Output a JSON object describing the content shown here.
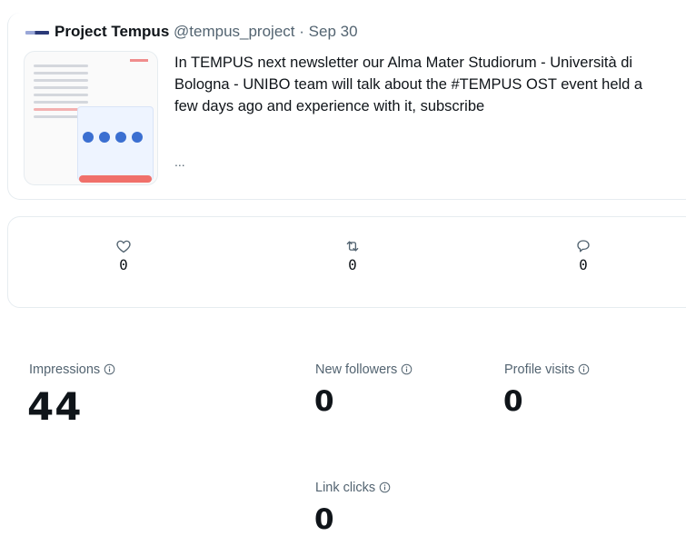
{
  "tweet": {
    "author_name": "Project Tempus",
    "handle": "@tempus_project",
    "separator": "·",
    "date": "Sep 30",
    "text": "In TEMPUS next newsletter our Alma Mater Studiorum - Università di Bologna - UNIBO team will talk about the #TEMPUS OST event held a few days ago and experience with it, subscribe",
    "more": "..."
  },
  "engagement": {
    "likes": "0",
    "retweets": "0",
    "replies": "0"
  },
  "metrics": {
    "impressions": {
      "label": "Impressions",
      "value": "44"
    },
    "new_followers": {
      "label": "New followers",
      "value": "0"
    },
    "profile_visits": {
      "label": "Profile visits",
      "value": "0"
    },
    "link_clicks": {
      "label": "Link clicks",
      "value": "0"
    }
  },
  "colors": {
    "text": "#0f1419",
    "secondary": "#536471",
    "border": "#e6ecf0"
  }
}
